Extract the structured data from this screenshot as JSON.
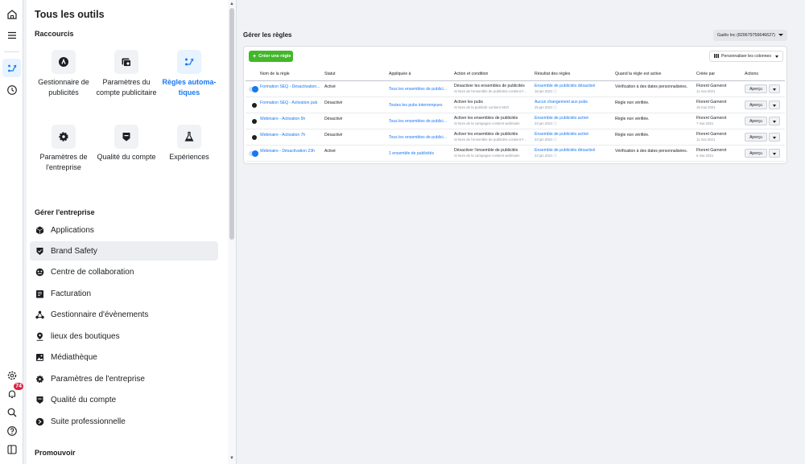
{
  "rail": {
    "badge": "74"
  },
  "sidebar": {
    "title": "Tous les outils",
    "shortcuts_title": "Raccourcis",
    "shortcuts": [
      {
        "label": "Gestionnaire de publicités",
        "icon": "ads-manager-icon"
      },
      {
        "label": "Paramètres du compte publicitaire",
        "icon": "ad-account-settings-icon"
      },
      {
        "label": "Règles automa-tiques",
        "icon": "automated-rules-icon",
        "active": true
      },
      {
        "label": "Paramètres de l'entreprise",
        "icon": "gear-icon"
      },
      {
        "label": "Qualité du compte",
        "icon": "shield-icon"
      },
      {
        "label": "Expériences",
        "icon": "flask-icon"
      }
    ],
    "manage_title": "Gérer l'entreprise",
    "manage_items": [
      {
        "label": "Applications",
        "icon": "cube-icon"
      },
      {
        "label": "Brand Safety",
        "icon": "shield-icon",
        "active": true
      },
      {
        "label": "Centre de collaboration",
        "icon": "handshake-icon"
      },
      {
        "label": "Facturation",
        "icon": "receipt-icon"
      },
      {
        "label": "Gestionnaire d'évènements",
        "icon": "events-icon"
      },
      {
        "label": "lieux des boutiques",
        "icon": "location-pin-icon"
      },
      {
        "label": "Médiathèque",
        "icon": "media-library-icon"
      },
      {
        "label": "Paramètres de l'entreprise",
        "icon": "gear-icon"
      },
      {
        "label": "Qualité du compte",
        "icon": "shield-icon"
      },
      {
        "label": "Suite professionnelle",
        "icon": "business-suite-icon"
      }
    ],
    "promote_title": "Promouvoir"
  },
  "main": {
    "title": "Gérer les règles",
    "account": "Gaëlo Inc (829679756646627)",
    "create_label": "Créer une règle",
    "customize_label": "Personnaliser les colonnes",
    "columns": [
      "Nom de la règle",
      "Statut",
      "Appliquée à",
      "Action et condition",
      "Résultat des règles",
      "Quand la règle est active",
      "Créée par",
      "Actions"
    ],
    "rows": [
      {
        "toggle": "on",
        "name": "Formation SEQ - Désactivation...",
        "status": "Activé",
        "applied": "Tous les ensembles de publici...",
        "action": "Désactiver les ensembles de publicités",
        "action_sub": "Si Nom de l'ensemble de publicités contient F...",
        "result": "Ensemble de publicités désactivé",
        "result_sub": "18 jan 2021 ⓘ",
        "when": "Vérification à des dates personnalisées.",
        "creator": "Florent Garnerot",
        "created": "11 mai 2021",
        "preview": "Aperçu"
      },
      {
        "toggle": "off",
        "name": "Formation SEQ - Activation pub",
        "status": "Désactivé",
        "applied": "Toutes les pubs interrompues",
        "action": "Activer les pubs",
        "action_sub": "Si Nom de la publicité contient SEO",
        "result": "Aucun changement aux pubs",
        "result_sub": "25 jan 2021 ⓘ",
        "when": "Règle non vérifiée.",
        "creator": "Florent Garnerot",
        "created": "18 mai 2021",
        "preview": "Aperçu"
      },
      {
        "toggle": "off",
        "name": "Webinaire - Activation 5h",
        "status": "Désactivé",
        "applied": "Tous les ensembles de publici...",
        "action": "Activer les ensembles de publicités",
        "action_sub": "Si Nom de la campagne contient webinaire",
        "result": "Ensemble de publicités activé",
        "result_sub": "23 jan 2021 ⓘ",
        "when": "Règle non vérifiée.",
        "creator": "Florent Garnerot",
        "created": "7 mai 2021",
        "preview": "Aperçu"
      },
      {
        "toggle": "off",
        "name": "Webinaire - Activation 7h",
        "status": "Désactivé",
        "applied": "Tous les ensembles de publici...",
        "action": "Activer les ensembles de publicités",
        "action_sub": "Si Nom de l'ensemble de publicités contient F...",
        "result": "Ensemble de publicités activé",
        "result_sub": "23 jan 2021 ⓘ",
        "when": "Règle non vérifiée.",
        "creator": "Florent Garnerot",
        "created": "11 mai 2021",
        "preview": "Aperçu"
      },
      {
        "toggle": "on",
        "name": "Webinaire - Désactivation 23h",
        "status": "Activé",
        "applied": "1 ensemble de publicités",
        "action": "Désactiver l'ensemble de publicités",
        "action_sub": "Si Nom de la campagne contient webinaire",
        "result": "Ensemble de publicités désactivé",
        "result_sub": "23 jan 2021 ⓘ",
        "when": "Vérification à des dates personnalisées.",
        "creator": "Florent Garnerot",
        "created": "6 mai 2021",
        "preview": "Aperçu"
      }
    ]
  },
  "colors": {
    "accent": "#1877f2",
    "create": "#42b72a",
    "badge": "#e41e3f"
  }
}
